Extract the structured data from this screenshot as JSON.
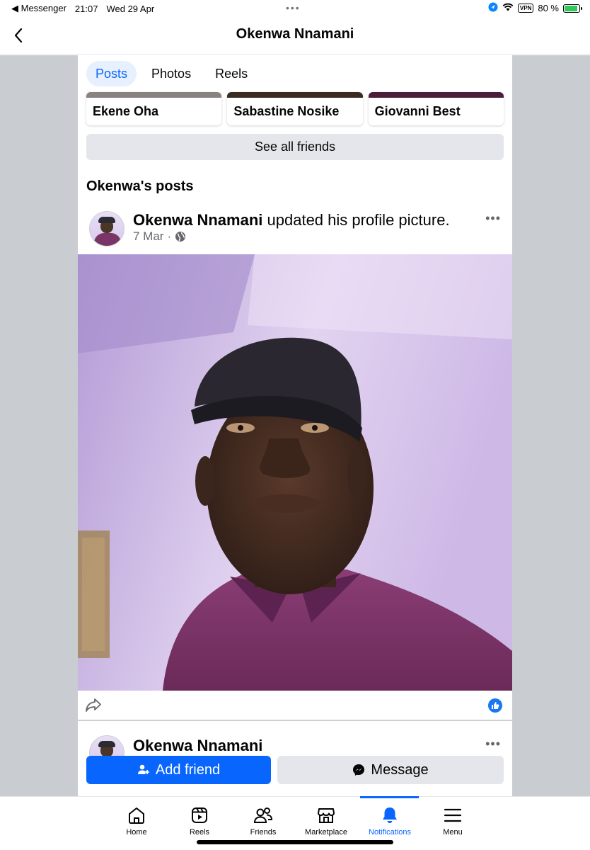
{
  "status_bar": {
    "back_app": "Messenger",
    "time": "21:07",
    "date": "Wed 29 Apr",
    "vpn": "VPN",
    "battery": "80 %",
    "battery_level": 0.8
  },
  "header": {
    "title": "Okenwa Nnamani"
  },
  "tabs": [
    {
      "label": "Posts",
      "active": true
    },
    {
      "label": "Photos",
      "active": false
    },
    {
      "label": "Reels",
      "active": false
    }
  ],
  "friends": [
    {
      "name": "Ekene Oha",
      "strip_color": "#8a8280"
    },
    {
      "name": "Sabastine Nosike",
      "strip_color": "#3a2a22"
    },
    {
      "name": "Giovanni Best",
      "strip_color": "#4a1d3a"
    }
  ],
  "see_all_friends": "See all friends",
  "posts_heading": "Okenwa's posts",
  "post": {
    "author": "Okenwa Nnamani",
    "action": "updated his profile picture.",
    "date": "7 Mar",
    "separator": "·",
    "more": "•••"
  },
  "next_post": {
    "author": "Okenwa Nnamani",
    "more": "•••"
  },
  "actions": {
    "add_friend": "Add friend",
    "message": "Message"
  },
  "bottom_nav": [
    {
      "label": "Home",
      "icon": "home-icon",
      "active": false
    },
    {
      "label": "Reels",
      "icon": "reels-icon",
      "active": false
    },
    {
      "label": "Friends",
      "icon": "friends-icon",
      "active": false
    },
    {
      "label": "Marketplace",
      "icon": "marketplace-icon",
      "active": false
    },
    {
      "label": "Notifications",
      "icon": "bell-icon",
      "active": true
    },
    {
      "label": "Menu",
      "icon": "menu-icon",
      "active": false
    }
  ],
  "colors": {
    "accent": "#0866ff",
    "side_gutter": "#c9ccd1"
  }
}
